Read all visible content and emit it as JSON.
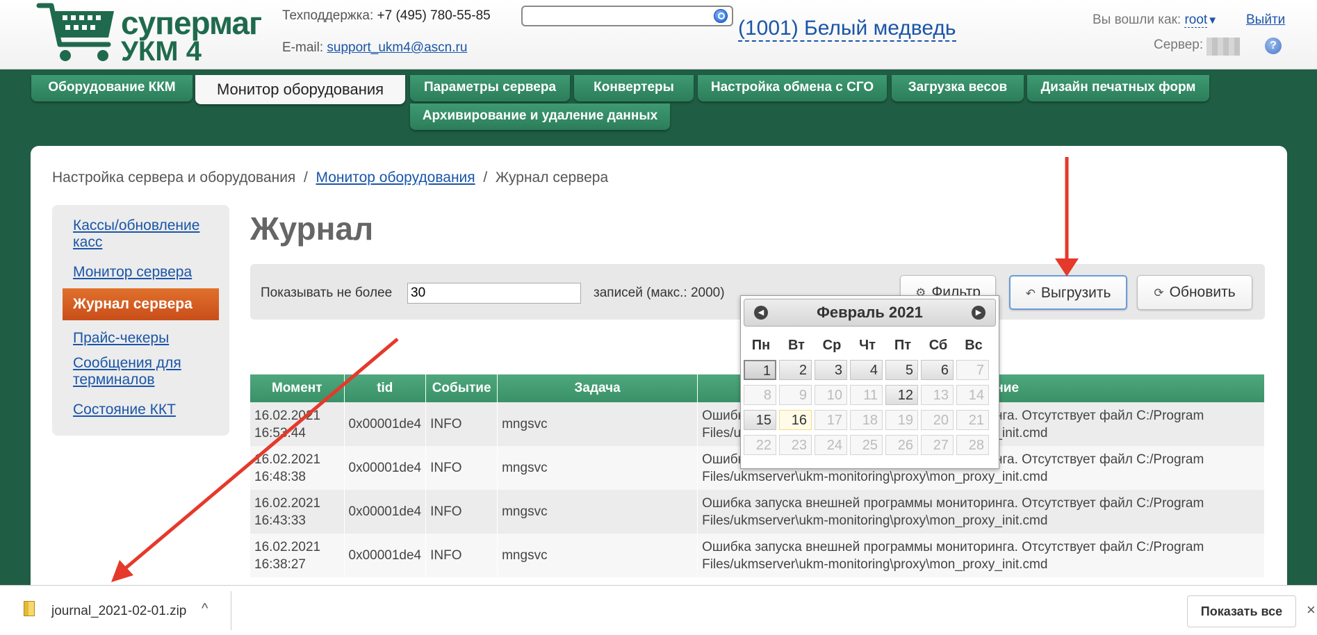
{
  "header": {
    "logo_line1": "супермаг",
    "logo_line2": "УКМ 4",
    "support_label": "Техподдержка:",
    "support_phone": "+7 (495) 780-55-85",
    "email_label": "E-mail:",
    "email": "support_ukm4@ascn.ru",
    "search_value": "",
    "store": "(1001) Белый медведь",
    "login_label": "Вы вошли как:",
    "user": "root",
    "logout": "Выйти",
    "server_label": "Сервер:",
    "help": "?"
  },
  "tabs": [
    {
      "label": "Оборудование ККМ"
    },
    {
      "label": "Монитор оборудования",
      "active": true
    },
    {
      "label": "Параметры сервера"
    },
    {
      "label": "Конвертеры"
    },
    {
      "label": "Настройка обмена с СГО"
    },
    {
      "label": "Загрузка весов"
    },
    {
      "label": "Дизайн печатных форм"
    },
    {
      "label": "Архивирование и удаление данных"
    }
  ],
  "breadcrumb": {
    "item1": "Настройка сервера и оборудования",
    "item2": "Монитор оборудования",
    "item3": "Журнал сервера",
    "sep": "/"
  },
  "sidebar": {
    "items": [
      {
        "label": "Кассы/обновление касс"
      },
      {
        "label": "Монитор сервера"
      },
      {
        "label": "Журнал сервера",
        "active": true
      },
      {
        "label": "Прайс-чекеры"
      },
      {
        "label": "Сообщения для терминалов"
      },
      {
        "label": "Состояние ККТ"
      }
    ]
  },
  "main": {
    "title": "Журнал",
    "limit_label": "Показывать не более",
    "limit_value": "30",
    "limit_suffix": "записей (макс.: 2000)",
    "filter_label": "Фильтр",
    "export_label": "Выгрузить",
    "refresh_label": "Обновить"
  },
  "table": {
    "headers": [
      "Момент",
      "tid",
      "Событие",
      "Задача",
      "Сообщение"
    ],
    "rows": [
      {
        "moment": "16.02.2021 16:53:44",
        "tid": "0x00001de4",
        "event": "INFO",
        "task": "mngsvc",
        "msg": "Ошибка запуска внешней программы мониторинга. Отсутствует файл C:/Program Files/ukmserver\\ukm-monitoring\\proxy\\mon_proxy_init.cmd"
      },
      {
        "moment": "16.02.2021 16:48:38",
        "tid": "0x00001de4",
        "event": "INFO",
        "task": "mngsvc",
        "msg": "Ошибка запуска внешней программы мониторинга. Отсутствует файл C:/Program Files/ukmserver\\ukm-monitoring\\proxy\\mon_proxy_init.cmd"
      },
      {
        "moment": "16.02.2021 16:43:33",
        "tid": "0x00001de4",
        "event": "INFO",
        "task": "mngsvc",
        "msg": "Ошибка запуска внешней программы мониторинга. Отсутствует файл C:/Program Files/ukmserver\\ukm-monitoring\\proxy\\mon_proxy_init.cmd"
      },
      {
        "moment": "16.02.2021 16:38:27",
        "tid": "0x00001de4",
        "event": "INFO",
        "task": "mngsvc",
        "msg": "Ошибка запуска внешней программы мониторинга. Отсутствует файл C:/Program Files/ukmserver\\ukm-monitoring\\proxy\\mon_proxy_init.cmd"
      }
    ]
  },
  "calendar": {
    "title": "Февраль 2021",
    "dow": [
      "Пн",
      "Вт",
      "Ср",
      "Чт",
      "Пт",
      "Сб",
      "Вс"
    ],
    "days": [
      "1",
      "2",
      "3",
      "4",
      "5",
      "6",
      "7",
      "8",
      "9",
      "10",
      "11",
      "12",
      "13",
      "14",
      "15",
      "16",
      "17",
      "18",
      "19",
      "20",
      "21",
      "22",
      "23",
      "24",
      "25",
      "26",
      "27",
      "28"
    ],
    "enabled": [
      "1",
      "2",
      "3",
      "4",
      "5",
      "6",
      "12",
      "15",
      "16"
    ],
    "selected": "1",
    "today": "16"
  },
  "download": {
    "filename": "journal_2021-02-01.zip",
    "show_all": "Показать все",
    "chevron": "^",
    "close": "×"
  },
  "colors": {
    "brand_green": "#1f5e44",
    "tab_green": "#3a9168",
    "link_blue": "#1a55a8",
    "active_orange": "#e0702c",
    "arrow_red": "#e5392b"
  }
}
